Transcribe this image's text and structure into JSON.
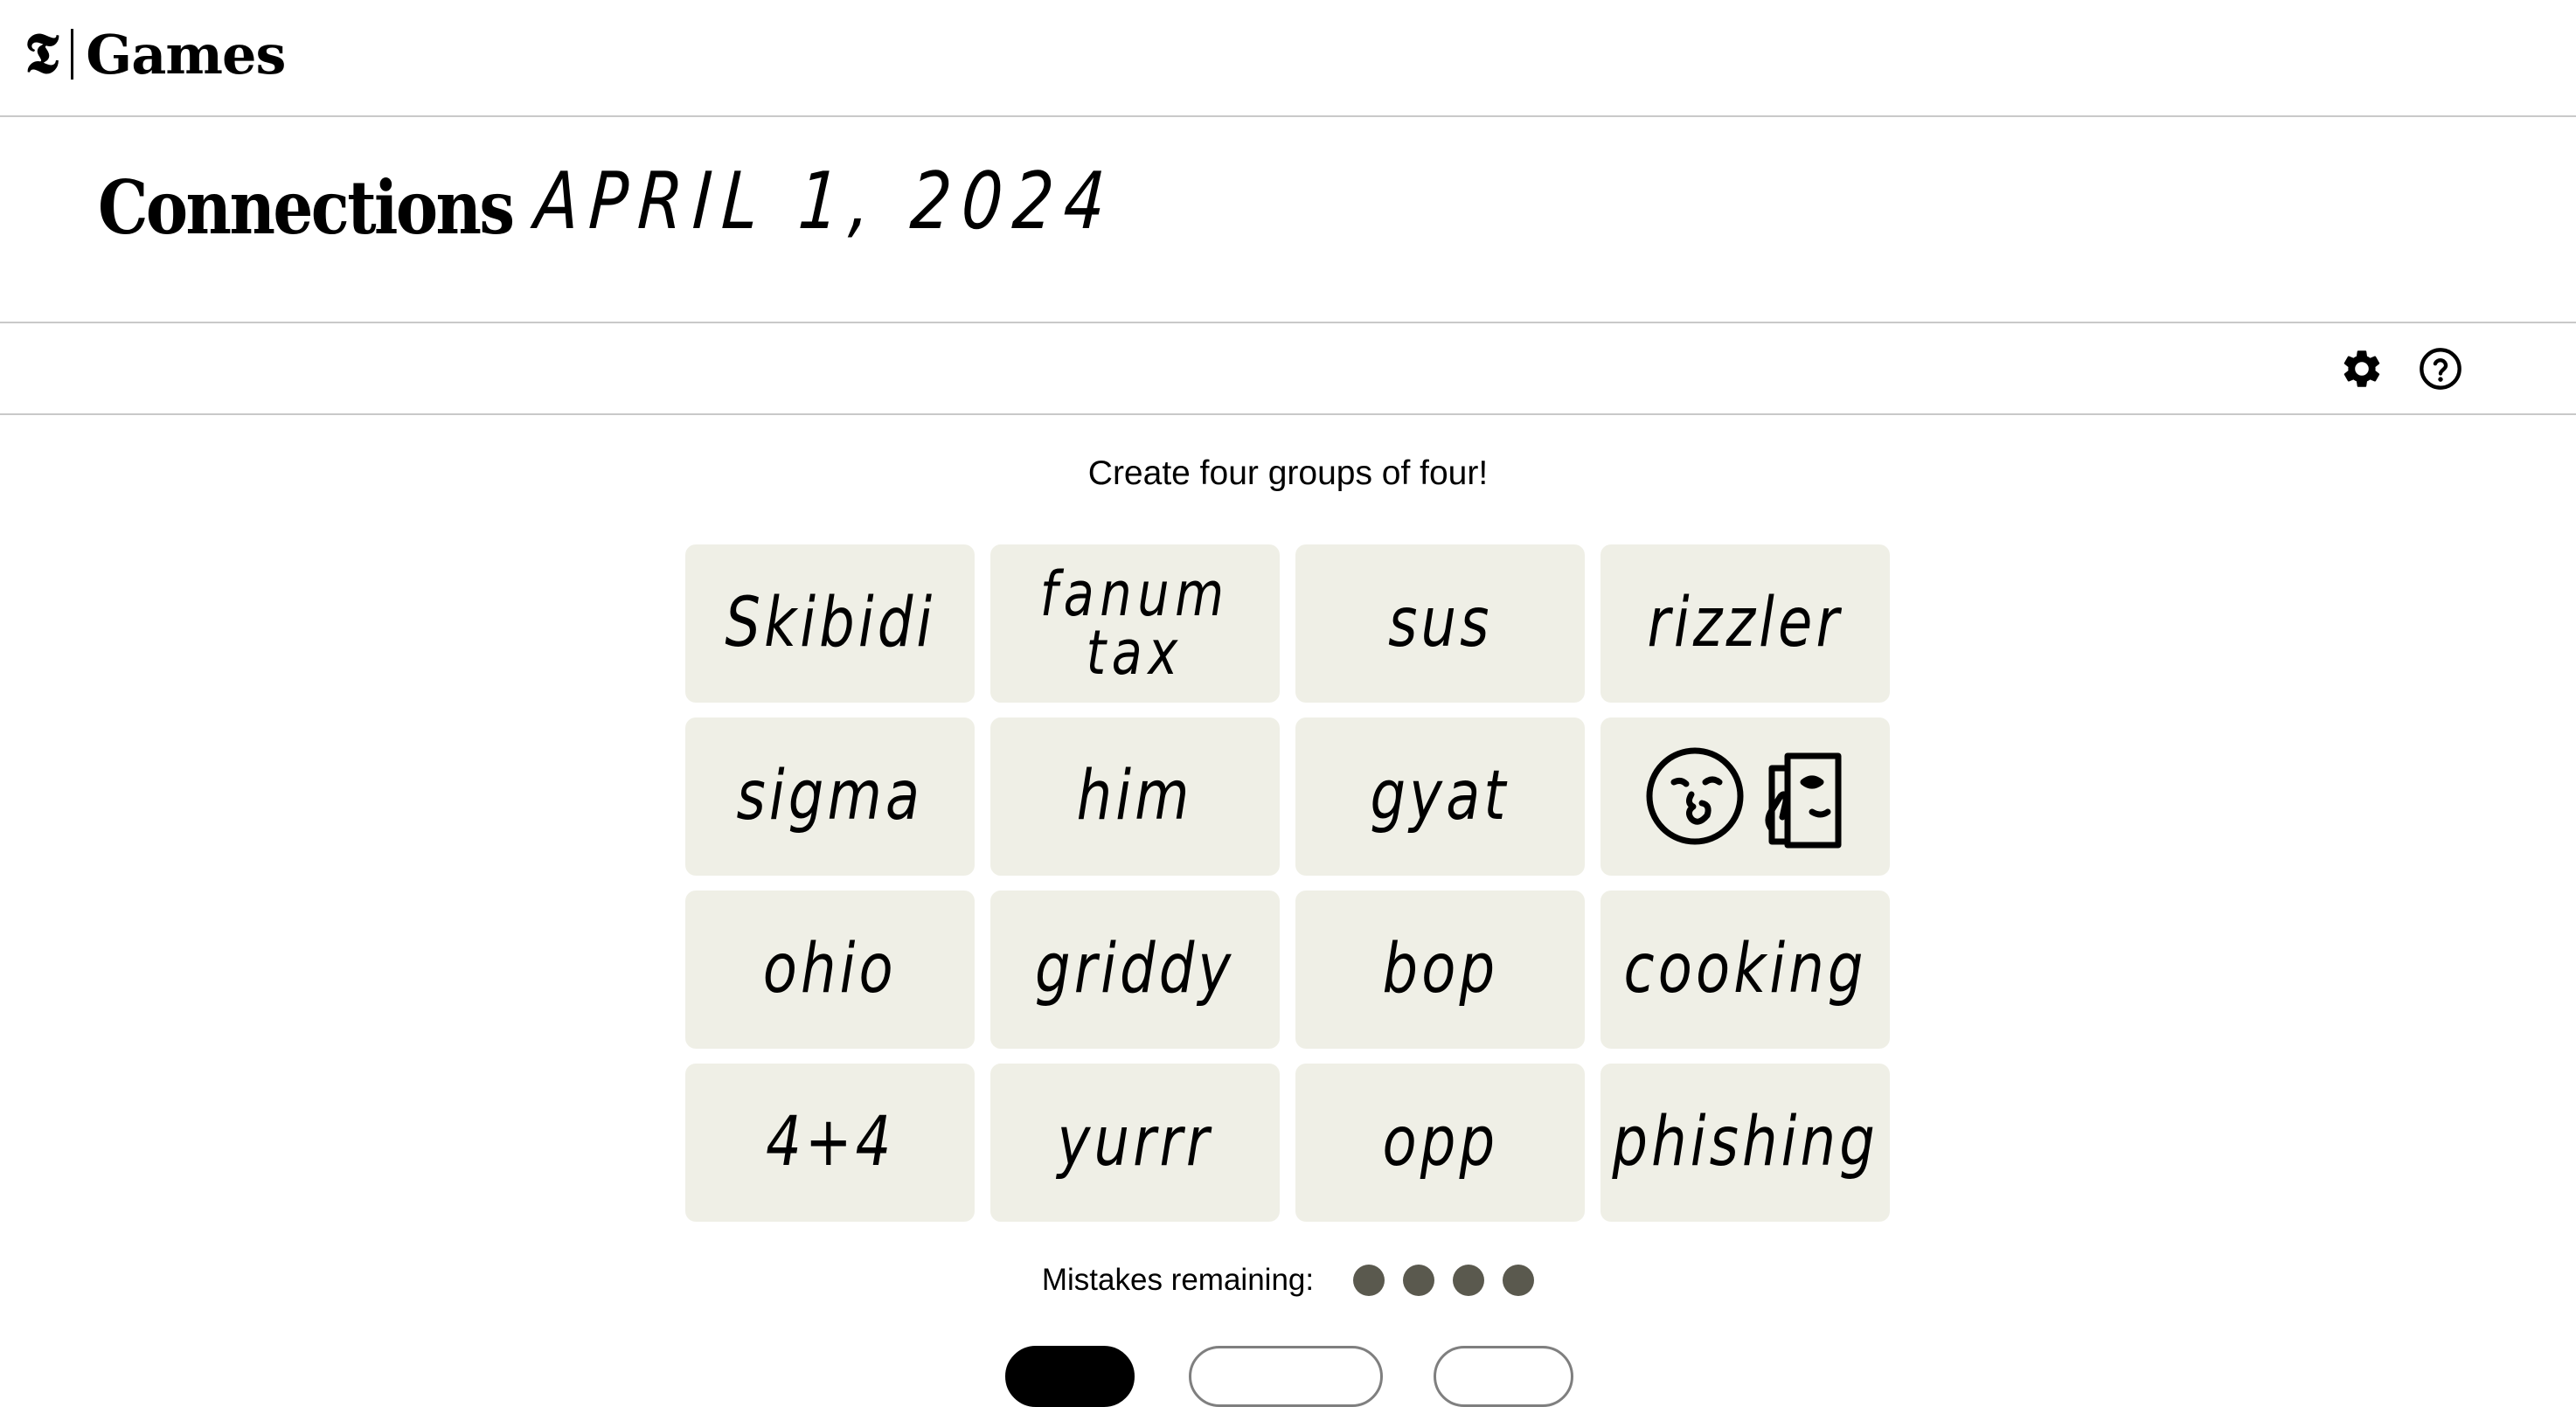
{
  "header": {
    "brand_logo": "𝕿",
    "brand_name": "Games"
  },
  "title": {
    "game": "Connections",
    "date": "APRIL 1, 2024"
  },
  "toolbar": {
    "settings_icon": "gear-icon",
    "help_icon": "question-circle-icon"
  },
  "instructions": "Create four groups of four!",
  "tiles": [
    {
      "label": "Skibidi"
    },
    {
      "label": "fanum\ntax"
    },
    {
      "label": "sus"
    },
    {
      "label": "rizzler"
    },
    {
      "label": "sigma"
    },
    {
      "label": "him"
    },
    {
      "label": "gyat"
    },
    {
      "label": "",
      "icon": "shush-face-mirror-icon"
    },
    {
      "label": "ohio"
    },
    {
      "label": "griddy"
    },
    {
      "label": "bop"
    },
    {
      "label": "cooking"
    },
    {
      "label": "4+4"
    },
    {
      "label": "yurrr"
    },
    {
      "label": "opp"
    },
    {
      "label": "phishing"
    }
  ],
  "mistakes": {
    "label": "Mistakes remaining:",
    "remaining": 4,
    "dot_color": "#5a594e"
  },
  "colors": {
    "tile_bg": "#efefe6",
    "divider": "#c9c9c9"
  }
}
